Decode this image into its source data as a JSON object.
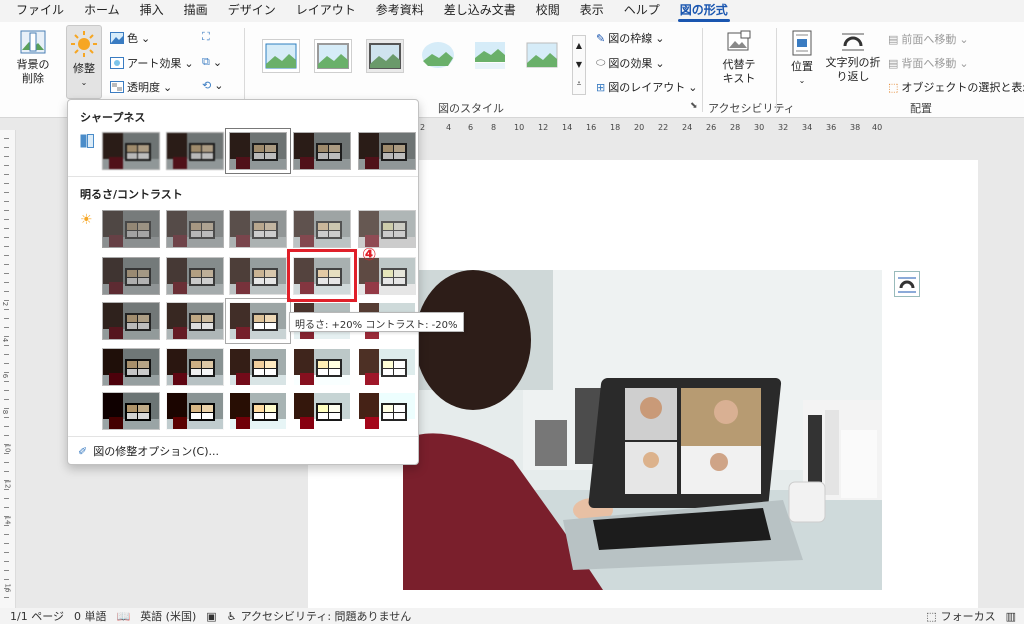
{
  "menubar": {
    "items": [
      "ファイル",
      "ホーム",
      "挿入",
      "描画",
      "デザイン",
      "レイアウト",
      "参考資料",
      "差し込み文書",
      "校閲",
      "表示",
      "ヘルプ",
      "図の形式"
    ],
    "active_index": 11
  },
  "ribbon": {
    "remove_bg": {
      "line1": "背景の",
      "line2": "削除"
    },
    "corrections": {
      "label": "修整"
    },
    "color": {
      "label": "色"
    },
    "artistic": {
      "label": "アート効果"
    },
    "transparency": {
      "label": "透明度"
    },
    "picture_styles_label": "図のスタイル",
    "border": {
      "label": "図の枠線"
    },
    "effects": {
      "label": "図の効果"
    },
    "layout": {
      "label": "図のレイアウト"
    },
    "alt_text": {
      "line1": "代替テ",
      "line2": "キスト"
    },
    "accessibility_label": "アクセシビリティ",
    "position": {
      "label": "位置"
    },
    "wrap_text": {
      "line1": "文字列の折",
      "line2": "り返し"
    },
    "bring_forward": {
      "label": "前面へ移動"
    },
    "send_backward": {
      "label": "背面へ移動"
    },
    "selection_pane": {
      "label": "オブジェクトの選択と表示"
    },
    "arrange_label": "配置"
  },
  "hruler_numbers": [
    "2",
    "4",
    "6",
    "8",
    "10",
    "12",
    "14",
    "16",
    "18",
    "20",
    "22",
    "24",
    "26",
    "28",
    "30",
    "32",
    "34",
    "36",
    "38",
    "40"
  ],
  "vruler_numbers": [
    "2",
    "4",
    "6",
    "8",
    "10",
    "12",
    "14",
    "16"
  ],
  "dropdown": {
    "sharpness_header": "シャープネス",
    "brightness_header": "明るさ/コントラスト",
    "options_label": "図の修整オプション(C)..."
  },
  "tooltip": "明るさ: +20% コントラスト: -20%",
  "step_marker": "④",
  "status": {
    "page": "1/1 ページ",
    "words": "0 単語",
    "language": "英語 (米国)",
    "accessibility": "アクセシビリティ: 問題ありません",
    "focus": "フォーカス"
  },
  "colors": {
    "accent": "#1a56b0",
    "highlight": "#e0202a"
  }
}
